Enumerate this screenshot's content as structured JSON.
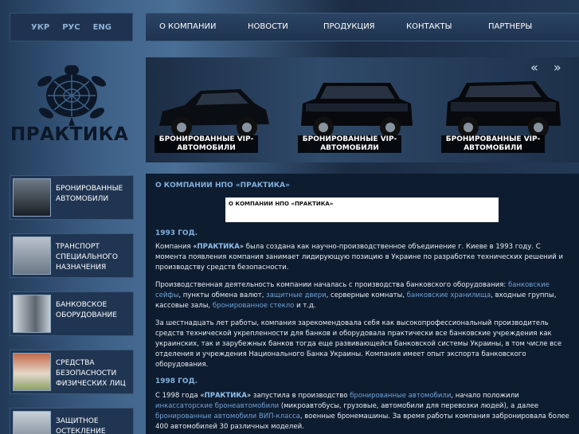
{
  "languages": [
    "УКР",
    "РУС",
    "ENG"
  ],
  "nav": [
    "О КОМПАНИИ",
    "НОВОСТИ",
    "ПРОДУКЦИЯ",
    "КОНТАКТЫ",
    "ПАРТНЕРЫ"
  ],
  "logo": {
    "text": "ПРАКТИКА"
  },
  "banner": {
    "prev": "«",
    "next": "»",
    "cars": [
      {
        "caption_l1": "БРОНИРОВАННЫЕ VIP-",
        "caption_l2": "АВТОМОБИЛИ"
      },
      {
        "caption_l1": "БРОНИРОВАННЫЕ VIP-",
        "caption_l2": "АВТОМОБИЛИ"
      },
      {
        "caption_l1": "БРОНИРОВАННЫЕ VIP-",
        "caption_l2": "АВТОМОБИЛИ"
      }
    ]
  },
  "sidebar": [
    {
      "l1": "БРОНИРОВАННЫЕ",
      "l2": "АВТОМОБИЛИ",
      "l3": ""
    },
    {
      "l1": "ТРАНСПОРТ",
      "l2": "СПЕЦИАЛЬНОГО",
      "l3": "НАЗНАЧЕНИЯ"
    },
    {
      "l1": "БАНКОВСКОЕ",
      "l2": "ОБОРУДОВАНИЕ",
      "l3": ""
    },
    {
      "l1": "СРЕДСТВА",
      "l2": "БЕЗОПАСНОСТИ",
      "l3": "ФИЗИЧЕСКИХ ЛИЦ"
    },
    {
      "l1": "ЗАЩИТНОЕ",
      "l2": "ОСТЕКЛЕНИЕ",
      "l3": ""
    }
  ],
  "content": {
    "title": "О КОМПАНИИ НПО «ПРАКТИКА»",
    "breadcrumb": "О КОМПАНИИ НПО «ПРАКТИКА»",
    "year1": "1993 ГОД.",
    "p1_a": "Компания «",
    "p1_b": "ПРАКТИКА",
    "p1_c": "» была создана как научно-производственное объединение г. Киеве в 1993 году. С момента появления компания занимает лидирующую позицию в Украине по разработке технических решений и производству средств безопасности.",
    "p2_a": "Производственная деятельность компании началась с производства банковского оборудования: ",
    "p2_link1": "банковские сейфы",
    "p2_b": ", пункты обмена валют, ",
    "p2_link2": "защитные двери",
    "p2_c": ", серверные комнаты, ",
    "p2_link3": "банковские хранилища",
    "p2_d": ", входные группы, кассовые залы, ",
    "p2_link4": "бронированное стекло",
    "p2_e": " и т.д.",
    "p3": "За шестнадцать лет работы, компания зарекомендовала себя как высокопрофессиональный производитель средств технической укрепленности для банков и оборудовала практически все банковские учреждения как украинских, так и зарубежных банков тогда еще развивающейся банковской системы Украины, в том числе все отделения и учреждения Национального Банка Украины. Компания имеет опыт экспорта банковского оборудования.",
    "year2": "1998 ГОД.",
    "p4_a": "С 1998 года «",
    "p4_b": "ПРАКТИКА",
    "p4_c": "» запустила в производство ",
    "p4_link1": "бронированные автомобили",
    "p4_d": ", начало положили ",
    "p4_link2": "инкассаторские бронеавтомобили",
    "p4_e": " (микроавтобусы, грузовые, автомобили для перевозки людей), а далее ",
    "p4_link3": "бронированные автомобили ВИП-класса",
    "p4_f": ", военные бронемашины. За время работы компания забронировала более 400 автомобилей 30 различных моделей."
  }
}
